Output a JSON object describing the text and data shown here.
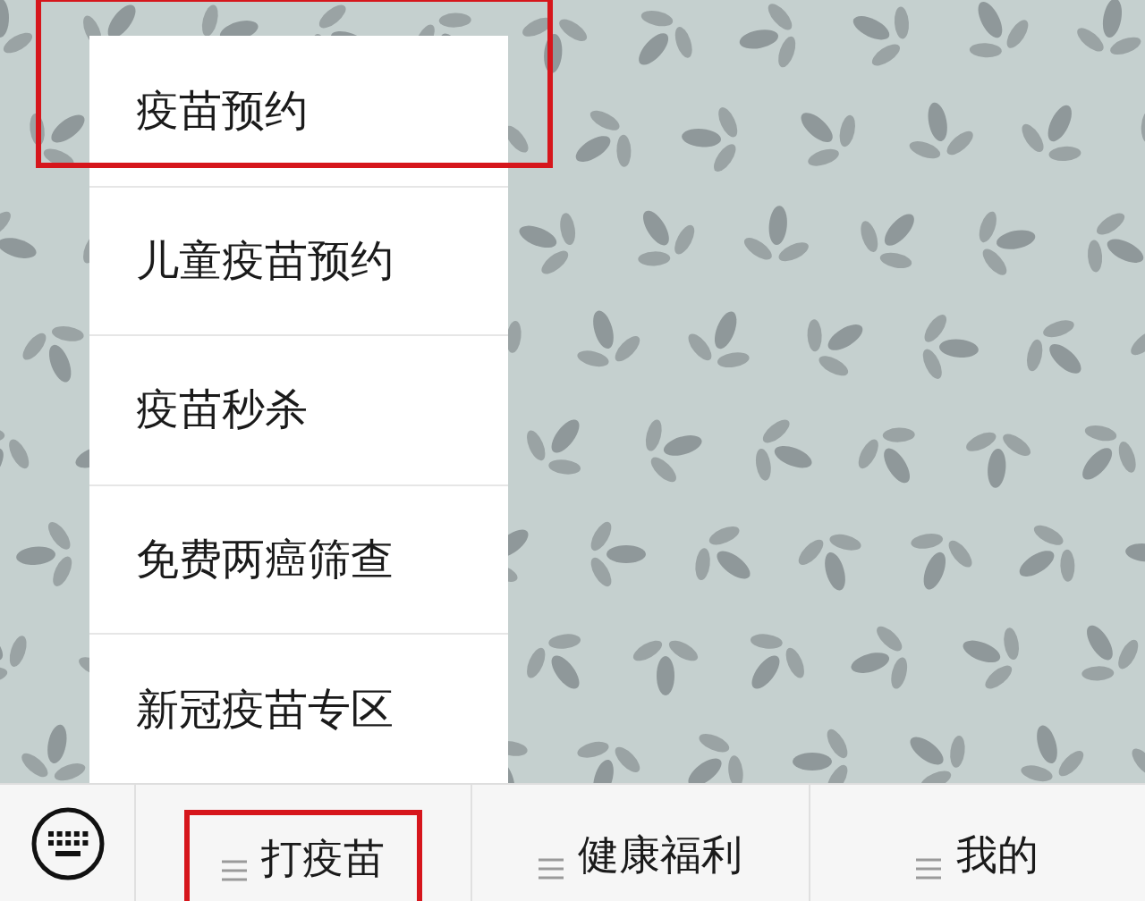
{
  "menu": {
    "items": [
      {
        "label": "疫苗预约",
        "highlighted": true
      },
      {
        "label": "儿童疫苗预约",
        "highlighted": false
      },
      {
        "label": "疫苗秒杀",
        "highlighted": false
      },
      {
        "label": "免费两癌筛查",
        "highlighted": false
      },
      {
        "label": "新冠疫苗专区",
        "highlighted": false
      }
    ]
  },
  "bottom_bar": {
    "tabs": [
      {
        "label": "打疫苗",
        "highlighted": true
      },
      {
        "label": "健康福利",
        "highlighted": false
      },
      {
        "label": "我的",
        "highlighted": false
      }
    ]
  }
}
